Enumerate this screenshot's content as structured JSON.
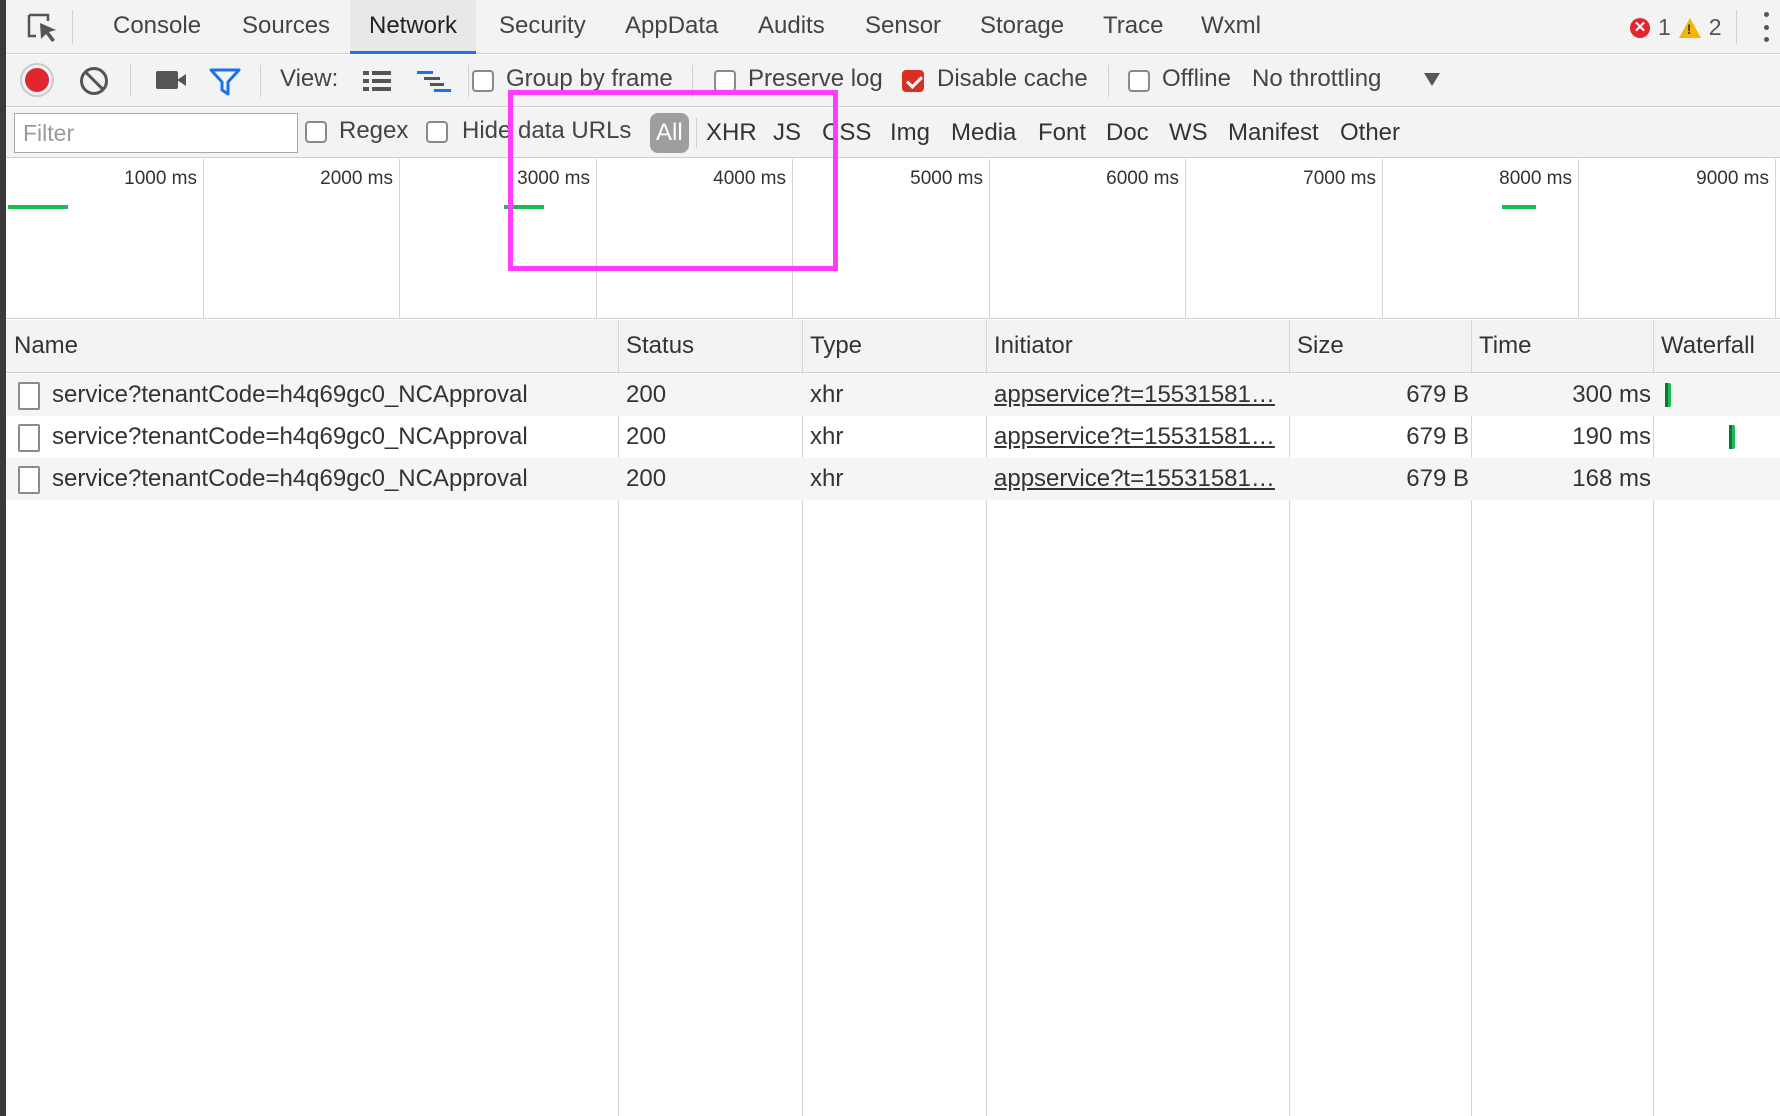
{
  "tabs": [
    {
      "label": "Console",
      "active": false
    },
    {
      "label": "Sources",
      "active": false
    },
    {
      "label": "Network",
      "active": true
    },
    {
      "label": "Security",
      "active": false
    },
    {
      "label": "AppData",
      "active": false
    },
    {
      "label": "Audits",
      "active": false
    },
    {
      "label": "Sensor",
      "active": false
    },
    {
      "label": "Storage",
      "active": false
    },
    {
      "label": "Trace",
      "active": false
    },
    {
      "label": "Wxml",
      "active": false
    }
  ],
  "status": {
    "errors": "1",
    "warnings": "2"
  },
  "toolbar": {
    "view_label": "View:",
    "group_by_frame": {
      "label": "Group by frame",
      "checked": false
    },
    "preserve_log": {
      "label": "Preserve log",
      "checked": false
    },
    "disable_cache": {
      "label": "Disable cache",
      "checked": true
    },
    "offline": {
      "label": "Offline",
      "checked": false
    },
    "throttling": "No throttling"
  },
  "filterbar": {
    "placeholder": "Filter",
    "regex": {
      "label": "Regex",
      "checked": false
    },
    "hide_data_urls": {
      "label": "Hide data URLs",
      "checked": false
    },
    "types": [
      "All",
      "XHR",
      "JS",
      "CSS",
      "Img",
      "Media",
      "Font",
      "Doc",
      "WS",
      "Manifest",
      "Other"
    ],
    "active_type": "All"
  },
  "overview": {
    "ticks": [
      "1000 ms",
      "2000 ms",
      "3000 ms",
      "4000 ms",
      "5000 ms",
      "6000 ms",
      "7000 ms",
      "8000 ms",
      "9000 ms"
    ]
  },
  "table": {
    "columns": [
      "Name",
      "Status",
      "Type",
      "Initiator",
      "Size",
      "Time",
      "Waterfall"
    ],
    "rows": [
      {
        "name": "service?tenantCode=h4q69gc0_NCApproval",
        "status": "200",
        "type": "xhr",
        "initiator": "appservice?t=15531581…",
        "size": "679 B",
        "time": "300 ms"
      },
      {
        "name": "service?tenantCode=h4q69gc0_NCApproval",
        "status": "200",
        "type": "xhr",
        "initiator": "appservice?t=15531581…",
        "size": "679 B",
        "time": "190 ms"
      },
      {
        "name": "service?tenantCode=h4q69gc0_NCApproval",
        "status": "200",
        "type": "xhr",
        "initiator": "appservice?t=15531581…",
        "size": "679 B",
        "time": "168 ms"
      }
    ]
  },
  "colors": {
    "accent": "#1a73e8",
    "record": "#e0262e",
    "bar": "#1db954",
    "highlight": "#ff3dff"
  }
}
